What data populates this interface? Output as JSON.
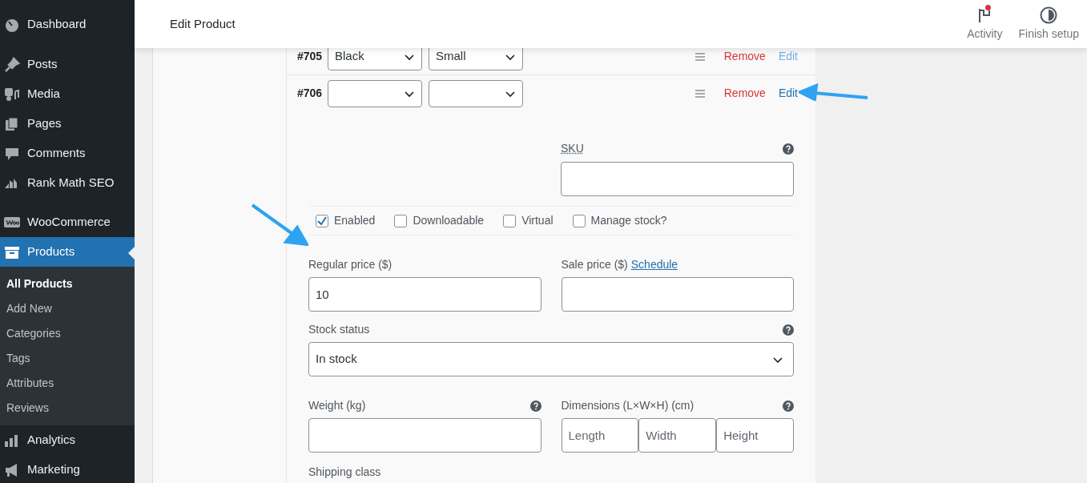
{
  "sidebar": {
    "items": [
      {
        "label": "Dashboard",
        "selected": false
      },
      {
        "label": "Posts",
        "selected": false
      },
      {
        "label": "Media",
        "selected": false
      },
      {
        "label": "Pages",
        "selected": false
      },
      {
        "label": "Comments",
        "selected": false
      },
      {
        "label": "Rank Math SEO",
        "selected": false
      },
      {
        "label": "WooCommerce",
        "selected": false
      },
      {
        "label": "Products",
        "selected": true,
        "children": [
          {
            "label": "All Products",
            "selected": true
          },
          {
            "label": "Add New",
            "selected": false
          },
          {
            "label": "Categories",
            "selected": false
          },
          {
            "label": "Tags",
            "selected": false
          },
          {
            "label": "Attributes",
            "selected": false
          },
          {
            "label": "Reviews",
            "selected": false
          }
        ]
      },
      {
        "label": "Analytics",
        "selected": false
      },
      {
        "label": "Marketing",
        "selected": false
      }
    ]
  },
  "header": {
    "title": "Edit Product",
    "actions": [
      {
        "label": "Activity",
        "kind": "flag",
        "notification": true
      },
      {
        "label": "Finish setup",
        "kind": "progress",
        "notification": false
      }
    ]
  },
  "variations": [
    {
      "id": "#705",
      "attributes": [
        "Black",
        "Small"
      ],
      "remove": "Remove",
      "edit": "Edit",
      "expanded": false
    },
    {
      "id": "#706",
      "remove": "Remove",
      "edit": "Edit",
      "expanded": true
    }
  ],
  "form": {
    "sku_label": "SKU",
    "options": [
      {
        "label": "Enabled",
        "checked": true
      },
      {
        "label": "Downloadable",
        "checked": false
      },
      {
        "label": "Virtual",
        "checked": false
      },
      {
        "label": "Manage stock?",
        "checked": false
      }
    ],
    "regular_price": {
      "label": "Regular price ($)",
      "value": "10"
    },
    "sale_price": {
      "label": "Sale price ($)",
      "link": "Schedule"
    },
    "stock_status": {
      "label": "Stock status",
      "value": "In stock"
    },
    "weight": {
      "label": "Weight (kg)"
    },
    "dimensions": {
      "label": "Dimensions (L×W×H) (cm)",
      "placeholders": [
        "Length",
        "Width",
        "Height"
      ]
    },
    "shipping_class": {
      "label": "Shipping class"
    }
  }
}
